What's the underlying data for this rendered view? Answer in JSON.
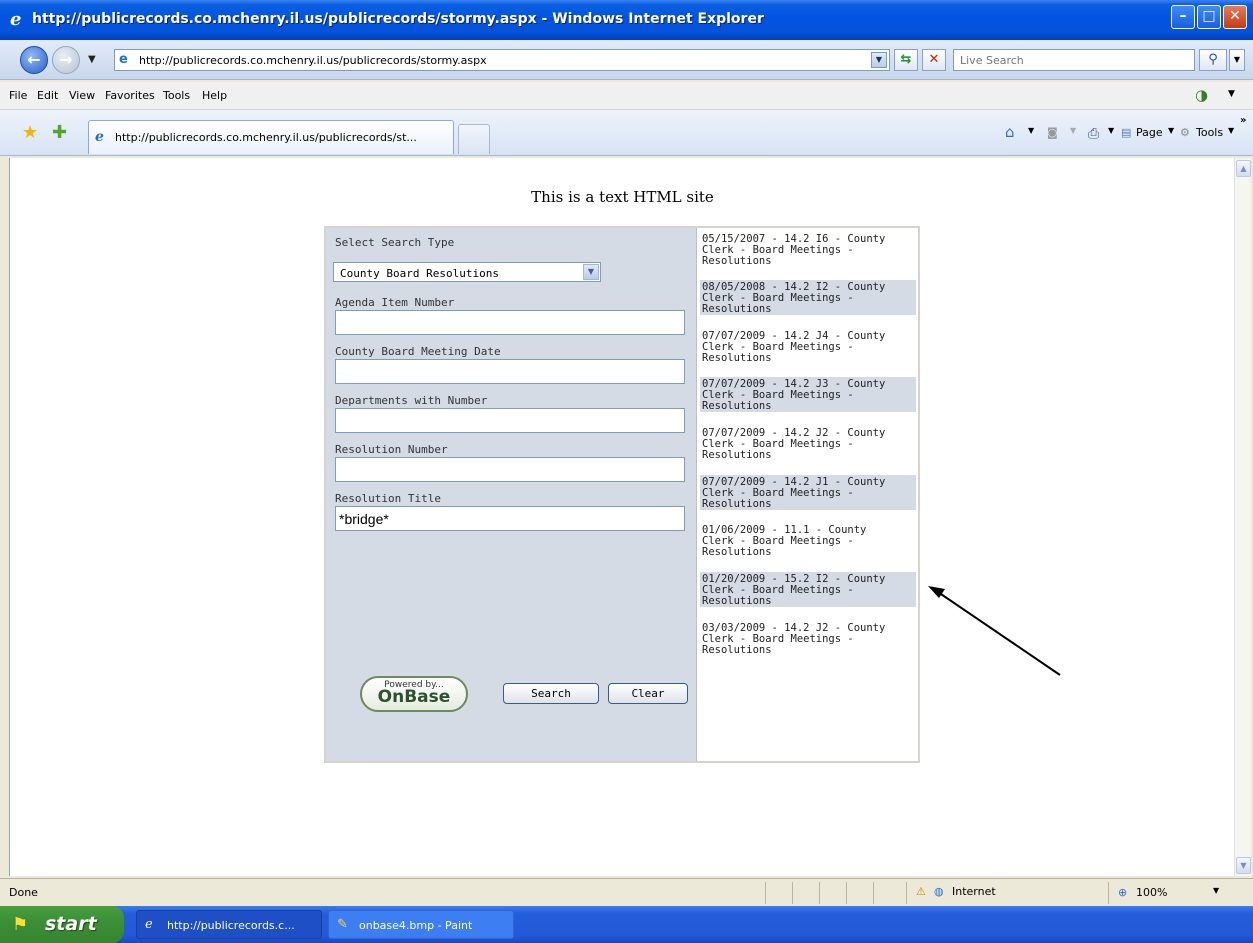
{
  "window": {
    "title": "http://publicrecords.co.mchenry.il.us/publicrecords/stormy.aspx - Windows Internet Explorer"
  },
  "address": {
    "url": "http://publicrecords.co.mchenry.il.us/publicrecords/stormy.aspx",
    "live_search_placeholder": "Live Search"
  },
  "menu": [
    "File",
    "Edit",
    "View",
    "Favorites",
    "Tools",
    "Help"
  ],
  "tab": {
    "title": "http://publicrecords.co.mchenry.il.us/publicrecords/st..."
  },
  "command_bar": {
    "page_label": "Page",
    "tools_label": "Tools"
  },
  "page": {
    "site_note": "This is a text HTML site",
    "form": {
      "search_type_label": "Select Search Type",
      "search_type_value": "County Board Resolutions",
      "fields": [
        {
          "label": "Agenda Item Number",
          "value": ""
        },
        {
          "label": "County Board Meeting Date",
          "value": ""
        },
        {
          "label": "Departments with Number",
          "value": ""
        },
        {
          "label": "Resolution Number",
          "value": ""
        },
        {
          "label": "Resolution Title",
          "value": "*bridge*"
        }
      ],
      "powered_by": "Powered by...",
      "brand": "OnBase",
      "search_button": "Search",
      "clear_button": "Clear"
    },
    "results": [
      {
        "line1": "05/15/2007 - 14.2 I6 - County",
        "line2": "Clerk - Board Meetings -",
        "line3": "Resolutions"
      },
      {
        "line1": "08/05/2008 - 14.2 I2 - County",
        "line2": "Clerk - Board Meetings -",
        "line3": "Resolutions"
      },
      {
        "line1": "07/07/2009 - 14.2 J4 - County",
        "line2": "Clerk - Board Meetings -",
        "line3": "Resolutions"
      },
      {
        "line1": "07/07/2009 - 14.2 J3 - County",
        "line2": "Clerk - Board Meetings -",
        "line3": "Resolutions"
      },
      {
        "line1": "07/07/2009 - 14.2 J2 - County",
        "line2": "Clerk - Board Meetings -",
        "line3": "Resolutions"
      },
      {
        "line1": "07/07/2009 - 14.2 J1 - County",
        "line2": "Clerk - Board Meetings -",
        "line3": "Resolutions"
      },
      {
        "line1": "01/06/2009 - 11.1 - County",
        "line2": "Clerk - Board Meetings -",
        "line3": "Resolutions"
      },
      {
        "line1": "01/20/2009 - 15.2 I2 - County",
        "line2": "Clerk - Board Meetings -",
        "line3": "Resolutions"
      },
      {
        "line1": "03/03/2009 - 14.2 J2 - County",
        "line2": "Clerk - Board Meetings -",
        "line3": "Resolutions"
      }
    ]
  },
  "status": {
    "text": "Done",
    "zone": "Internet",
    "zoom": "100%"
  },
  "taskbar": {
    "start_label": "start",
    "items": [
      "http://publicrecords.c...",
      "onbase4.bmp - Paint"
    ]
  },
  "colors": {
    "titlebar": "#0154e1",
    "panel_bg": "#d5dbe5",
    "start_green": "#3c8f37"
  }
}
